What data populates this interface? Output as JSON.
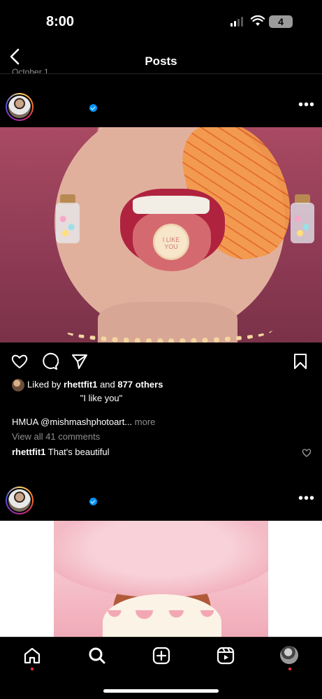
{
  "status_bar": {
    "time": "8:00",
    "battery": "4"
  },
  "header": {
    "title": "Posts",
    "previous_date": "October 1"
  },
  "posts": [
    {
      "likes": {
        "liked_by_prefix": "Liked by",
        "liked_by_user": "rhettfit1",
        "and": "and",
        "others": "877 others"
      },
      "caption_quote": "\"I like you\"",
      "caption": "HMUA @mishmashphotoart...",
      "more_label": "more",
      "view_comments": "View all 41 comments",
      "comment": {
        "user": "rhettfit1",
        "text": "That's beautiful"
      },
      "candy_text": "I LIKE YOU"
    }
  ],
  "icons": {
    "back": "back-chevron-icon",
    "verified": "verified-badge-icon",
    "more": "more-options-icon",
    "like": "heart-outline-icon",
    "comment": "comment-icon",
    "share": "send-icon",
    "save": "bookmark-icon",
    "tab_home": "home-icon",
    "tab_search": "search-icon",
    "tab_create": "create-plus-icon",
    "tab_reels": "reels-icon",
    "tab_profile": "profile-avatar"
  },
  "colors": {
    "background": "#000000",
    "verified": "#0095f6",
    "notification_dot": "#ff3040",
    "muted_text": "#8e8e8e"
  }
}
